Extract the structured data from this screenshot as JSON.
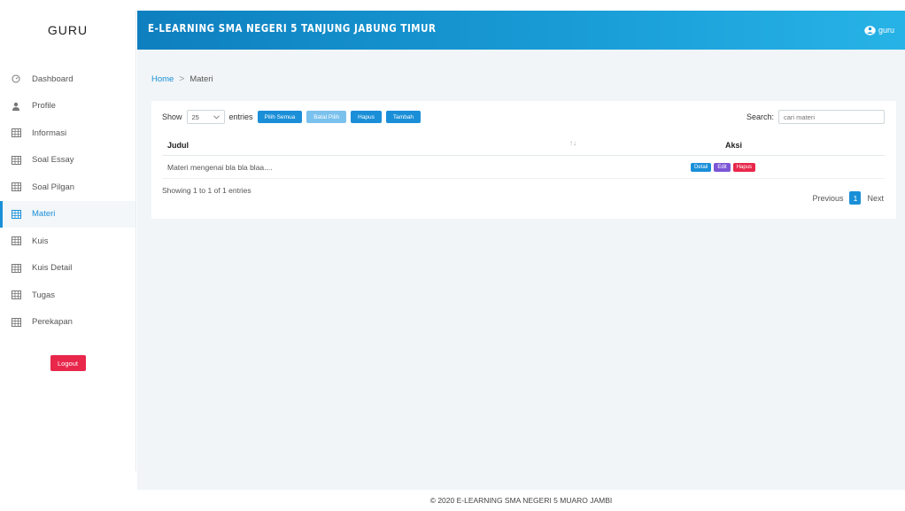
{
  "sidebar": {
    "brand": "GURU",
    "items": [
      {
        "label": "Dashboard",
        "icon": "dashboard-icon",
        "active": false
      },
      {
        "label": "Profile",
        "icon": "user-icon",
        "active": false
      },
      {
        "label": "Informasi",
        "icon": "table-icon",
        "active": false
      },
      {
        "label": "Soal Essay",
        "icon": "table-icon",
        "active": false
      },
      {
        "label": "Soal Pilgan",
        "icon": "table-icon",
        "active": false
      },
      {
        "label": "Materi",
        "icon": "table-icon",
        "active": true
      },
      {
        "label": "Kuis",
        "icon": "table-icon",
        "active": false
      },
      {
        "label": "Kuis Detail",
        "icon": "table-icon",
        "active": false
      },
      {
        "label": "Tugas",
        "icon": "table-icon",
        "active": false
      },
      {
        "label": "Perekapan",
        "icon": "table-icon",
        "active": false
      }
    ],
    "logout_label": "Logout"
  },
  "header": {
    "title": "E-LEARNING SMA NEGERI 5 TANJUNG JABUNG TIMUR",
    "user_name": "guru"
  },
  "breadcrumb": {
    "home": "Home",
    "separator": ">",
    "current": "Materi"
  },
  "table_controls": {
    "show_label": "Show",
    "page_size": "25",
    "entries_label": "entries",
    "pilih_semua": "Pilih Semua",
    "batal_pilih": "Batal Pilih",
    "hapus": "Hapus",
    "tambah": "Tambah",
    "search_label": "Search:",
    "search_placeholder": "cari materi"
  },
  "table": {
    "columns": [
      "Judul",
      "Aksi"
    ],
    "sort_icon": "↑↓",
    "rows": [
      {
        "judul": "Materi mengenai bla bla blaa....",
        "detail": "Detail",
        "edit": "Edit",
        "hapus": "Hapus"
      }
    ]
  },
  "pagination": {
    "info": "Showing 1 to 1 of 1 entries",
    "previous": "Previous",
    "current_page": "1",
    "next": "Next"
  },
  "footer": {
    "text": "© 2020 E-LEARNING SMA NEGERI 5 MUARO JAMBI"
  },
  "colors": {
    "accent": "#1a8fd8",
    "danger": "#e8274b",
    "purple": "#7b55d6",
    "light_blue": "#7bc1ee",
    "background": "#f1f5f7"
  }
}
